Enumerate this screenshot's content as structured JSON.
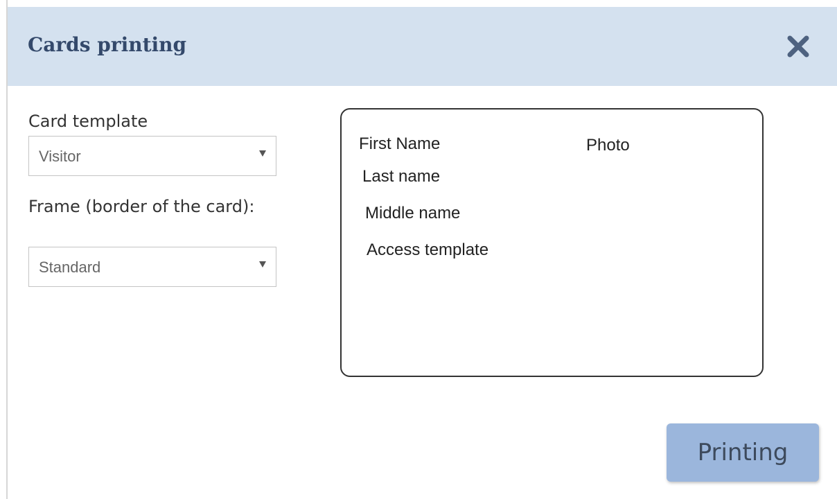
{
  "dialog": {
    "title": "Cards printing",
    "close_icon": "close-icon",
    "header_color": "#d4e1ef",
    "title_color": "#34496b"
  },
  "form": {
    "card_template": {
      "label": "Card template",
      "value": "Visitor"
    },
    "frame": {
      "label": "Frame (border of the card):",
      "value": "Standard"
    }
  },
  "card_preview": {
    "first_name": "First Name",
    "photo": "Photo",
    "last_name": "Last name",
    "middle_name": "Middle name",
    "access_template": "Access template"
  },
  "actions": {
    "print_label": "Printing",
    "print_color": "#9bb6dc"
  }
}
